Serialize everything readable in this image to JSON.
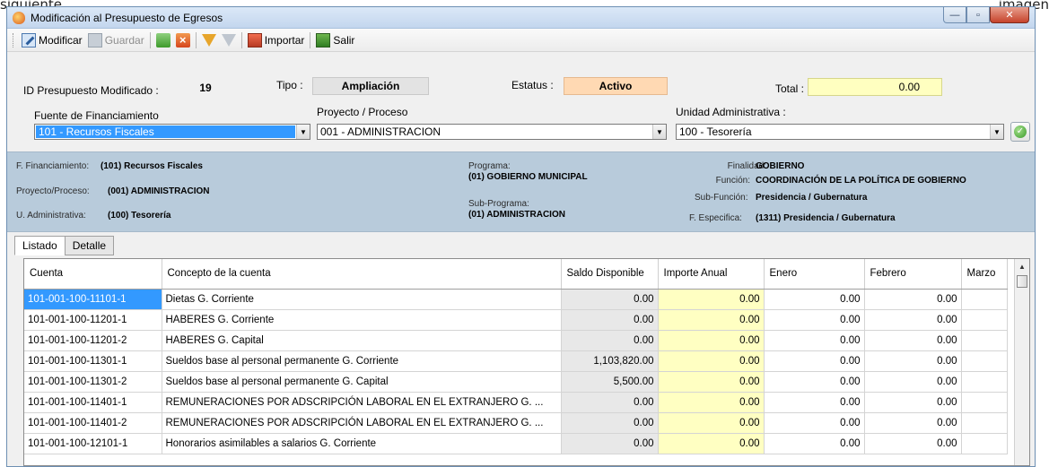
{
  "background": {
    "left_text": "siguiente",
    "right_text": "imagen"
  },
  "window": {
    "title": "Modificación al Presupuesto de Egresos",
    "controls": {
      "minimize": "—",
      "maximize": "▫",
      "close": "✕"
    }
  },
  "toolbar": {
    "modificar": "Modificar",
    "guardar": "Guardar",
    "importar": "Importar",
    "salir": "Salir"
  },
  "header": {
    "id_label": "ID Presupuesto Modificado :",
    "id_value": "19",
    "tipo_label": "Tipo :",
    "tipo_value": "Ampliación",
    "estatus_label": "Estatus :",
    "estatus_value": "Activo",
    "total_label": "Total :",
    "total_value": "0.00"
  },
  "filters": {
    "fuente_label": "Fuente de Financiamiento",
    "fuente_value": "101 - Recursos Fiscales",
    "proyecto_label": "Proyecto / Proceso",
    "proyecto_value": "001 - ADMINISTRACION",
    "unidad_label": "Unidad Administrativa :",
    "unidad_value": "100 - Tesorería"
  },
  "summary": {
    "ffin_label": "F. Financiamiento:",
    "ffin_value": "(101) Recursos Fiscales",
    "proy_label": "Proyecto/Proceso:",
    "proy_value": "(001) ADMINISTRACION",
    "uadm_label": "U. Administrativa:",
    "uadm_value": "(100) Tesorería",
    "programa_label": "Programa:",
    "programa_value": "(01) GOBIERNO MUNICIPAL",
    "subprog_label": "Sub-Programa:",
    "subprog_value": "(01) ADMINISTRACION",
    "finalidad_label": "Finalidad:",
    "finalidad_value": "GOBIERNO",
    "funcion_label": "Función:",
    "funcion_value": "COORDINACIÓN DE LA POLÍTICA DE GOBIERNO",
    "subfuncion_label": "Sub-Función:",
    "subfuncion_value": "Presidencia / Gubernatura",
    "fesp_label": "F. Especifica:",
    "fesp_value": "(1311) Presidencia / Gubernatura"
  },
  "tabs": [
    "Listado",
    "Detalle"
  ],
  "grid": {
    "columns": [
      "Cuenta",
      "Concepto de la cuenta",
      "Saldo Disponible",
      "Importe Anual",
      "Enero",
      "Febrero",
      "Marzo"
    ],
    "rows": [
      {
        "cuenta": "101-001-100-11101-1",
        "concepto": "Dietas G. Corriente",
        "saldo": "0.00",
        "importe": "0.00",
        "enero": "0.00",
        "febrero": "0.00"
      },
      {
        "cuenta": "101-001-100-11201-1",
        "concepto": "HABERES G. Corriente",
        "saldo": "0.00",
        "importe": "0.00",
        "enero": "0.00",
        "febrero": "0.00"
      },
      {
        "cuenta": "101-001-100-11201-2",
        "concepto": "HABERES G. Capital",
        "saldo": "0.00",
        "importe": "0.00",
        "enero": "0.00",
        "febrero": "0.00"
      },
      {
        "cuenta": "101-001-100-11301-1",
        "concepto": "Sueldos base al personal permanente G. Corriente",
        "saldo": "1,103,820.00",
        "importe": "0.00",
        "enero": "0.00",
        "febrero": "0.00"
      },
      {
        "cuenta": "101-001-100-11301-2",
        "concepto": "Sueldos base al personal permanente G. Capital",
        "saldo": "5,500.00",
        "importe": "0.00",
        "enero": "0.00",
        "febrero": "0.00"
      },
      {
        "cuenta": "101-001-100-11401-1",
        "concepto": "REMUNERACIONES POR ADSCRIPCIÓN LABORAL EN EL EXTRANJERO G. ...",
        "saldo": "0.00",
        "importe": "0.00",
        "enero": "0.00",
        "febrero": "0.00"
      },
      {
        "cuenta": "101-001-100-11401-2",
        "concepto": "REMUNERACIONES POR ADSCRIPCIÓN LABORAL EN EL EXTRANJERO G. ...",
        "saldo": "0.00",
        "importe": "0.00",
        "enero": "0.00",
        "febrero": "0.00"
      },
      {
        "cuenta": "101-001-100-12101-1",
        "concepto": "Honorarios asimilables a salarios G. Corriente",
        "saldo": "0.00",
        "importe": "0.00",
        "enero": "0.00",
        "febrero": "0.00"
      }
    ]
  }
}
